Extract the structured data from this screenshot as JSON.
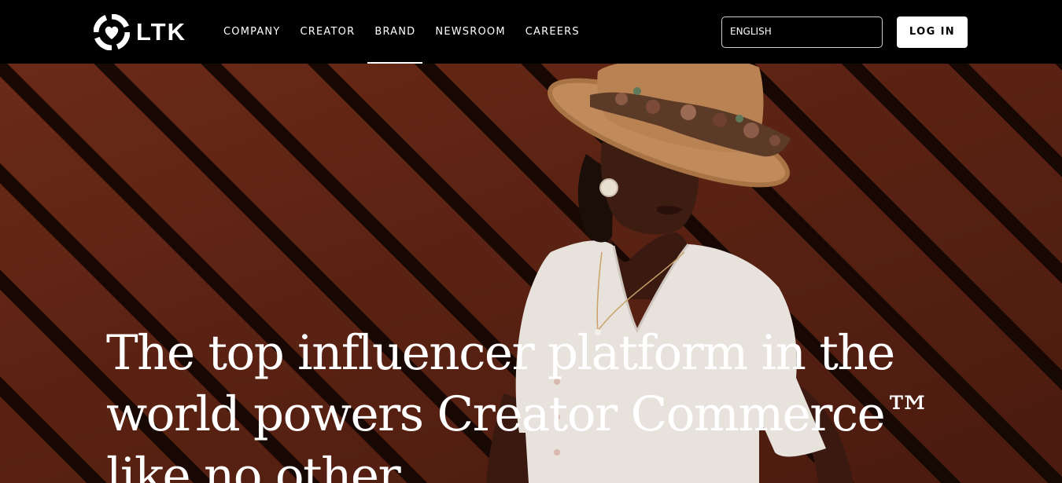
{
  "header": {
    "logo_text": "LTK",
    "nav": [
      {
        "label": "COMPANY"
      },
      {
        "label": "CREATOR"
      },
      {
        "label": "BRAND"
      },
      {
        "label": "NEWSROOM"
      },
      {
        "label": "CAREERS"
      }
    ],
    "active_nav": "BRAND",
    "language_select": {
      "value": "ENGLISH"
    },
    "login_label": "LOG IN"
  },
  "hero": {
    "headline": "The top influencer platform in the world powers Creator Commerce™ like no other"
  },
  "colors": {
    "header_bg": "#000000",
    "text": "#ffffff",
    "wood": "#5a2213"
  },
  "icons": [
    "ltk-logo-icon"
  ]
}
